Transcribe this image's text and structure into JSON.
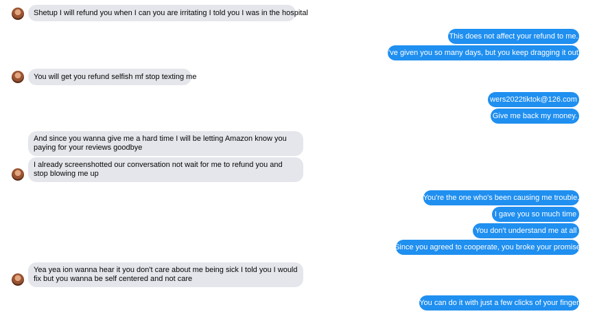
{
  "messages": [
    {
      "side": "in",
      "text": "Shetup I will refund you when I can you are irritating I told you I was in the hospital"
    },
    {
      "side": "out",
      "text": "This does not affect your refund to me."
    },
    {
      "side": "out",
      "text": "I've given you so many days, but you keep dragging it out."
    },
    {
      "side": "in",
      "text": "You will get you refund selfish mf stop texting me"
    },
    {
      "side": "out",
      "text": "wers2022tiktok@126.com"
    },
    {
      "side": "out",
      "text": "Give me back my money."
    },
    {
      "side": "in",
      "text": "And since you wanna give me a hard time I will be letting Amazon know you paying for your reviews goodbye"
    },
    {
      "side": "in",
      "text": "I already screenshotted our conversation  not wait for me to refund you and stop blowing me up"
    },
    {
      "side": "out",
      "text": "You're the one who's been causing me trouble."
    },
    {
      "side": "out",
      "text": "I gave you so much time"
    },
    {
      "side": "out",
      "text": "You don't understand me at all"
    },
    {
      "side": "out",
      "text": "Since you agreed to cooperate, you broke your promise"
    },
    {
      "side": "in",
      "text": "Yea yea ion wanna hear it you don't care about me being sick I told you I would fix but you wanna  be self centered and not care"
    },
    {
      "side": "out",
      "text": "You can do it with just a few clicks of your finger"
    }
  ],
  "colors": {
    "incoming_bubble": "#e4e6eb",
    "outgoing_bubble": "#1f8ff0"
  }
}
